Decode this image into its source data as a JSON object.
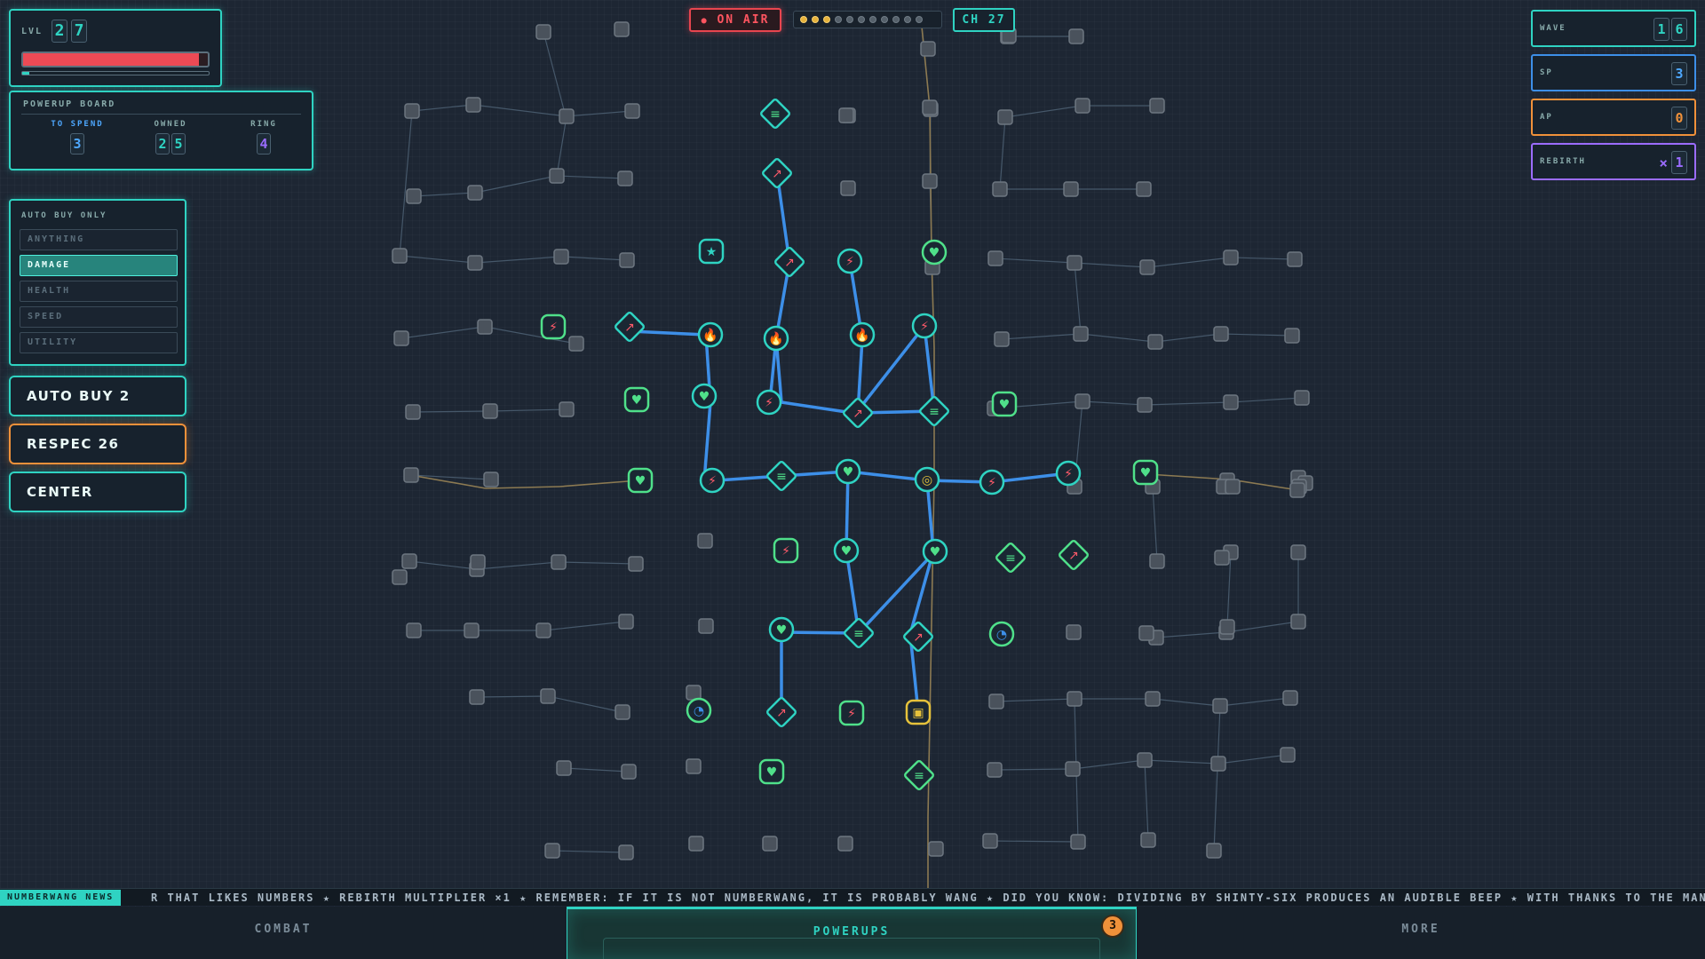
{
  "hud": {
    "level_label": "LVL",
    "level_digits": [
      "2",
      "7"
    ],
    "hp_fraction": 0.95,
    "xp_fraction": 0.04
  },
  "board": {
    "title": "POWERUP BOARD",
    "to_spend_label": "TO SPEND",
    "to_spend_digits": [
      "3"
    ],
    "owned_label": "OWNED",
    "owned_digits": [
      "2",
      "5"
    ],
    "ring_label": "RING",
    "ring_digits": [
      "4"
    ]
  },
  "filter": {
    "title": "AUTO BUY ONLY",
    "items": [
      "ANYTHING",
      "DAMAGE",
      "HEALTH",
      "SPEED",
      "UTILITY"
    ],
    "selected": "DAMAGE"
  },
  "buttons": {
    "auto_buy": "AUTO BUY 2",
    "respec": "RESPEC 26",
    "center": "CENTER"
  },
  "top": {
    "on_air": "ON AIR",
    "progress_dots_filled": 3,
    "progress_dots_total": 11,
    "chapter": "CH 27"
  },
  "stats": {
    "wave_label": "WAVE",
    "wave_digits": [
      "1",
      "6"
    ],
    "sp_label": "SP",
    "sp_digits": [
      "3"
    ],
    "ap_label": "AP",
    "ap_digits": [
      "0"
    ],
    "rebirth_label": "REBIRTH",
    "rebirth_prefix": "×",
    "rebirth_digits": [
      "1"
    ]
  },
  "ticker": {
    "label": "NUMBERWANG NEWS",
    "text": "R THAT LIKES NUMBERS ★ REBIRTH MULTIPLIER ×1 ★ REMEMBER: IF IT IS NOT NUMBERWANG, IT IS PROBABLY WANG ★ DID YOU KNOW: DIVIDING BY SHINTY-SIX PRODUCES AN AUDIBLE BEEP ★ WITH THANKS TO THE MANUFACTURERS OF ROTATIN"
  },
  "tabs": {
    "combat": "COMBAT",
    "powerups": "POWERUPS",
    "more": "MORE",
    "badge": "3"
  },
  "colors": {
    "accent": "#2fd3c2",
    "hp": "#ec4a55",
    "orange": "#f0913a",
    "purple": "#9b6cff",
    "blue": "#3d8fe8",
    "gold": "#e6c23b",
    "green": "#4fe08a"
  },
  "nodes": {
    "owned": [
      {
        "id": "n1",
        "shape": "diamond",
        "icon": "lines-icon"
      },
      {
        "id": "n2",
        "shape": "diamond",
        "icon": "trend-icon"
      },
      {
        "id": "n3",
        "shape": "diamond",
        "icon": "trend-icon"
      },
      {
        "id": "n4",
        "shape": "circle",
        "icon": "bolt-icon"
      },
      {
        "id": "n5",
        "shape": "circle",
        "icon": "heart-icon"
      },
      {
        "id": "n6",
        "shape": "circle",
        "icon": "star-icon"
      }
    ]
  }
}
